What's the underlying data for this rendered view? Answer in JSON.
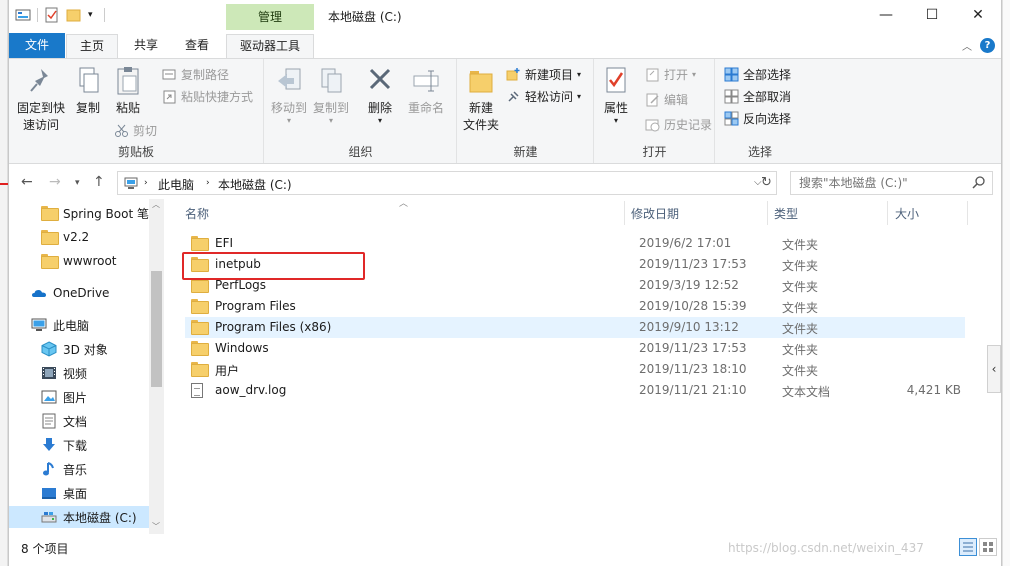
{
  "window": {
    "title": "本地磁盘 (C:)",
    "context_tab_header": "管理",
    "controls": {
      "minimize": "—",
      "maximize": "☐",
      "close": "✕"
    }
  },
  "ribbon_tabs": [
    {
      "label": "文件",
      "active": false
    },
    {
      "label": "主页",
      "active": true
    },
    {
      "label": "共享",
      "active": false
    },
    {
      "label": "查看",
      "active": false
    },
    {
      "label": "驱动器工具",
      "active": false
    }
  ],
  "ribbon": {
    "clipboard": {
      "group_label": "剪贴板",
      "pin_label": "固定到快\n速访问",
      "copy_label": "复制",
      "paste_label": "粘贴",
      "copy_path_label": "复制路径",
      "paste_shortcut_label": "粘贴快捷方式",
      "cut_label": "剪切"
    },
    "organize": {
      "group_label": "组织",
      "move_to_label": "移动到",
      "copy_to_label": "复制到",
      "delete_label": "删除",
      "rename_label": "重命名"
    },
    "new": {
      "group_label": "新建",
      "new_folder_label": "新建\n文件夹",
      "new_item_label": "新建项目",
      "easy_access_label": "轻松访问"
    },
    "open": {
      "group_label": "打开",
      "properties_label": "属性",
      "open_label": "打开",
      "edit_label": "编辑",
      "history_label": "历史记录"
    },
    "select": {
      "group_label": "选择",
      "select_all_label": "全部选择",
      "select_none_label": "全部取消",
      "invert_label": "反向选择"
    }
  },
  "address": {
    "crumbs": [
      "此电脑",
      "本地磁盘 (C:)"
    ],
    "search_placeholder": "搜索\"本地磁盘 (C:)\""
  },
  "nav_pane": {
    "items": [
      {
        "label": "Spring Boot 笔",
        "icon": "folder-icon"
      },
      {
        "label": "v2.2",
        "icon": "folder-icon"
      },
      {
        "label": "wwwroot",
        "icon": "folder-icon"
      },
      {
        "label": "OneDrive",
        "icon": "onedrive-icon"
      },
      {
        "label": "此电脑",
        "icon": "this-pc-icon"
      },
      {
        "label": "3D 对象",
        "icon": "3d-objects-icon"
      },
      {
        "label": "视频",
        "icon": "video-icon"
      },
      {
        "label": "图片",
        "icon": "pictures-icon"
      },
      {
        "label": "文档",
        "icon": "documents-icon"
      },
      {
        "label": "下载",
        "icon": "download-icon"
      },
      {
        "label": "音乐",
        "icon": "music-icon"
      },
      {
        "label": "桌面",
        "icon": "desktop-icon"
      },
      {
        "label": "本地磁盘 (C:)",
        "icon": "drive-icon",
        "selected": true
      }
    ]
  },
  "file_list": {
    "columns": {
      "name": "名称",
      "date": "修改日期",
      "type": "类型",
      "size": "大小"
    },
    "rows": [
      {
        "name": "EFI",
        "date": "2019/6/2 17:01",
        "type": "文件夹",
        "size": ""
      },
      {
        "name": "inetpub",
        "date": "2019/11/23 17:53",
        "type": "文件夹",
        "size": ""
      },
      {
        "name": "PerfLogs",
        "date": "2019/3/19 12:52",
        "type": "文件夹",
        "size": ""
      },
      {
        "name": "Program Files",
        "date": "2019/10/28 15:39",
        "type": "文件夹",
        "size": ""
      },
      {
        "name": "Program Files (x86)",
        "date": "2019/9/10 13:12",
        "type": "文件夹",
        "size": ""
      },
      {
        "name": "Windows",
        "date": "2019/11/23 17:53",
        "type": "文件夹",
        "size": ""
      },
      {
        "name": "用户",
        "date": "2019/11/23 18:10",
        "type": "文件夹",
        "size": ""
      },
      {
        "name": "aow_drv.log",
        "date": "2019/11/21 21:10",
        "type": "文本文档",
        "size": "4,421 KB"
      }
    ],
    "hovered_row": "Program Files (x86)",
    "annotated_row": "inetpub"
  },
  "status_bar": {
    "item_count": "8 个项目"
  },
  "watermark": "https://blog.csdn.net/weixin_437",
  "colors": {
    "file_tab": "#1979ca",
    "context_tab": "#cde8b8",
    "selection": "#cce8ff",
    "hover": "#e5f3ff",
    "annotation_box": "#e02828"
  }
}
